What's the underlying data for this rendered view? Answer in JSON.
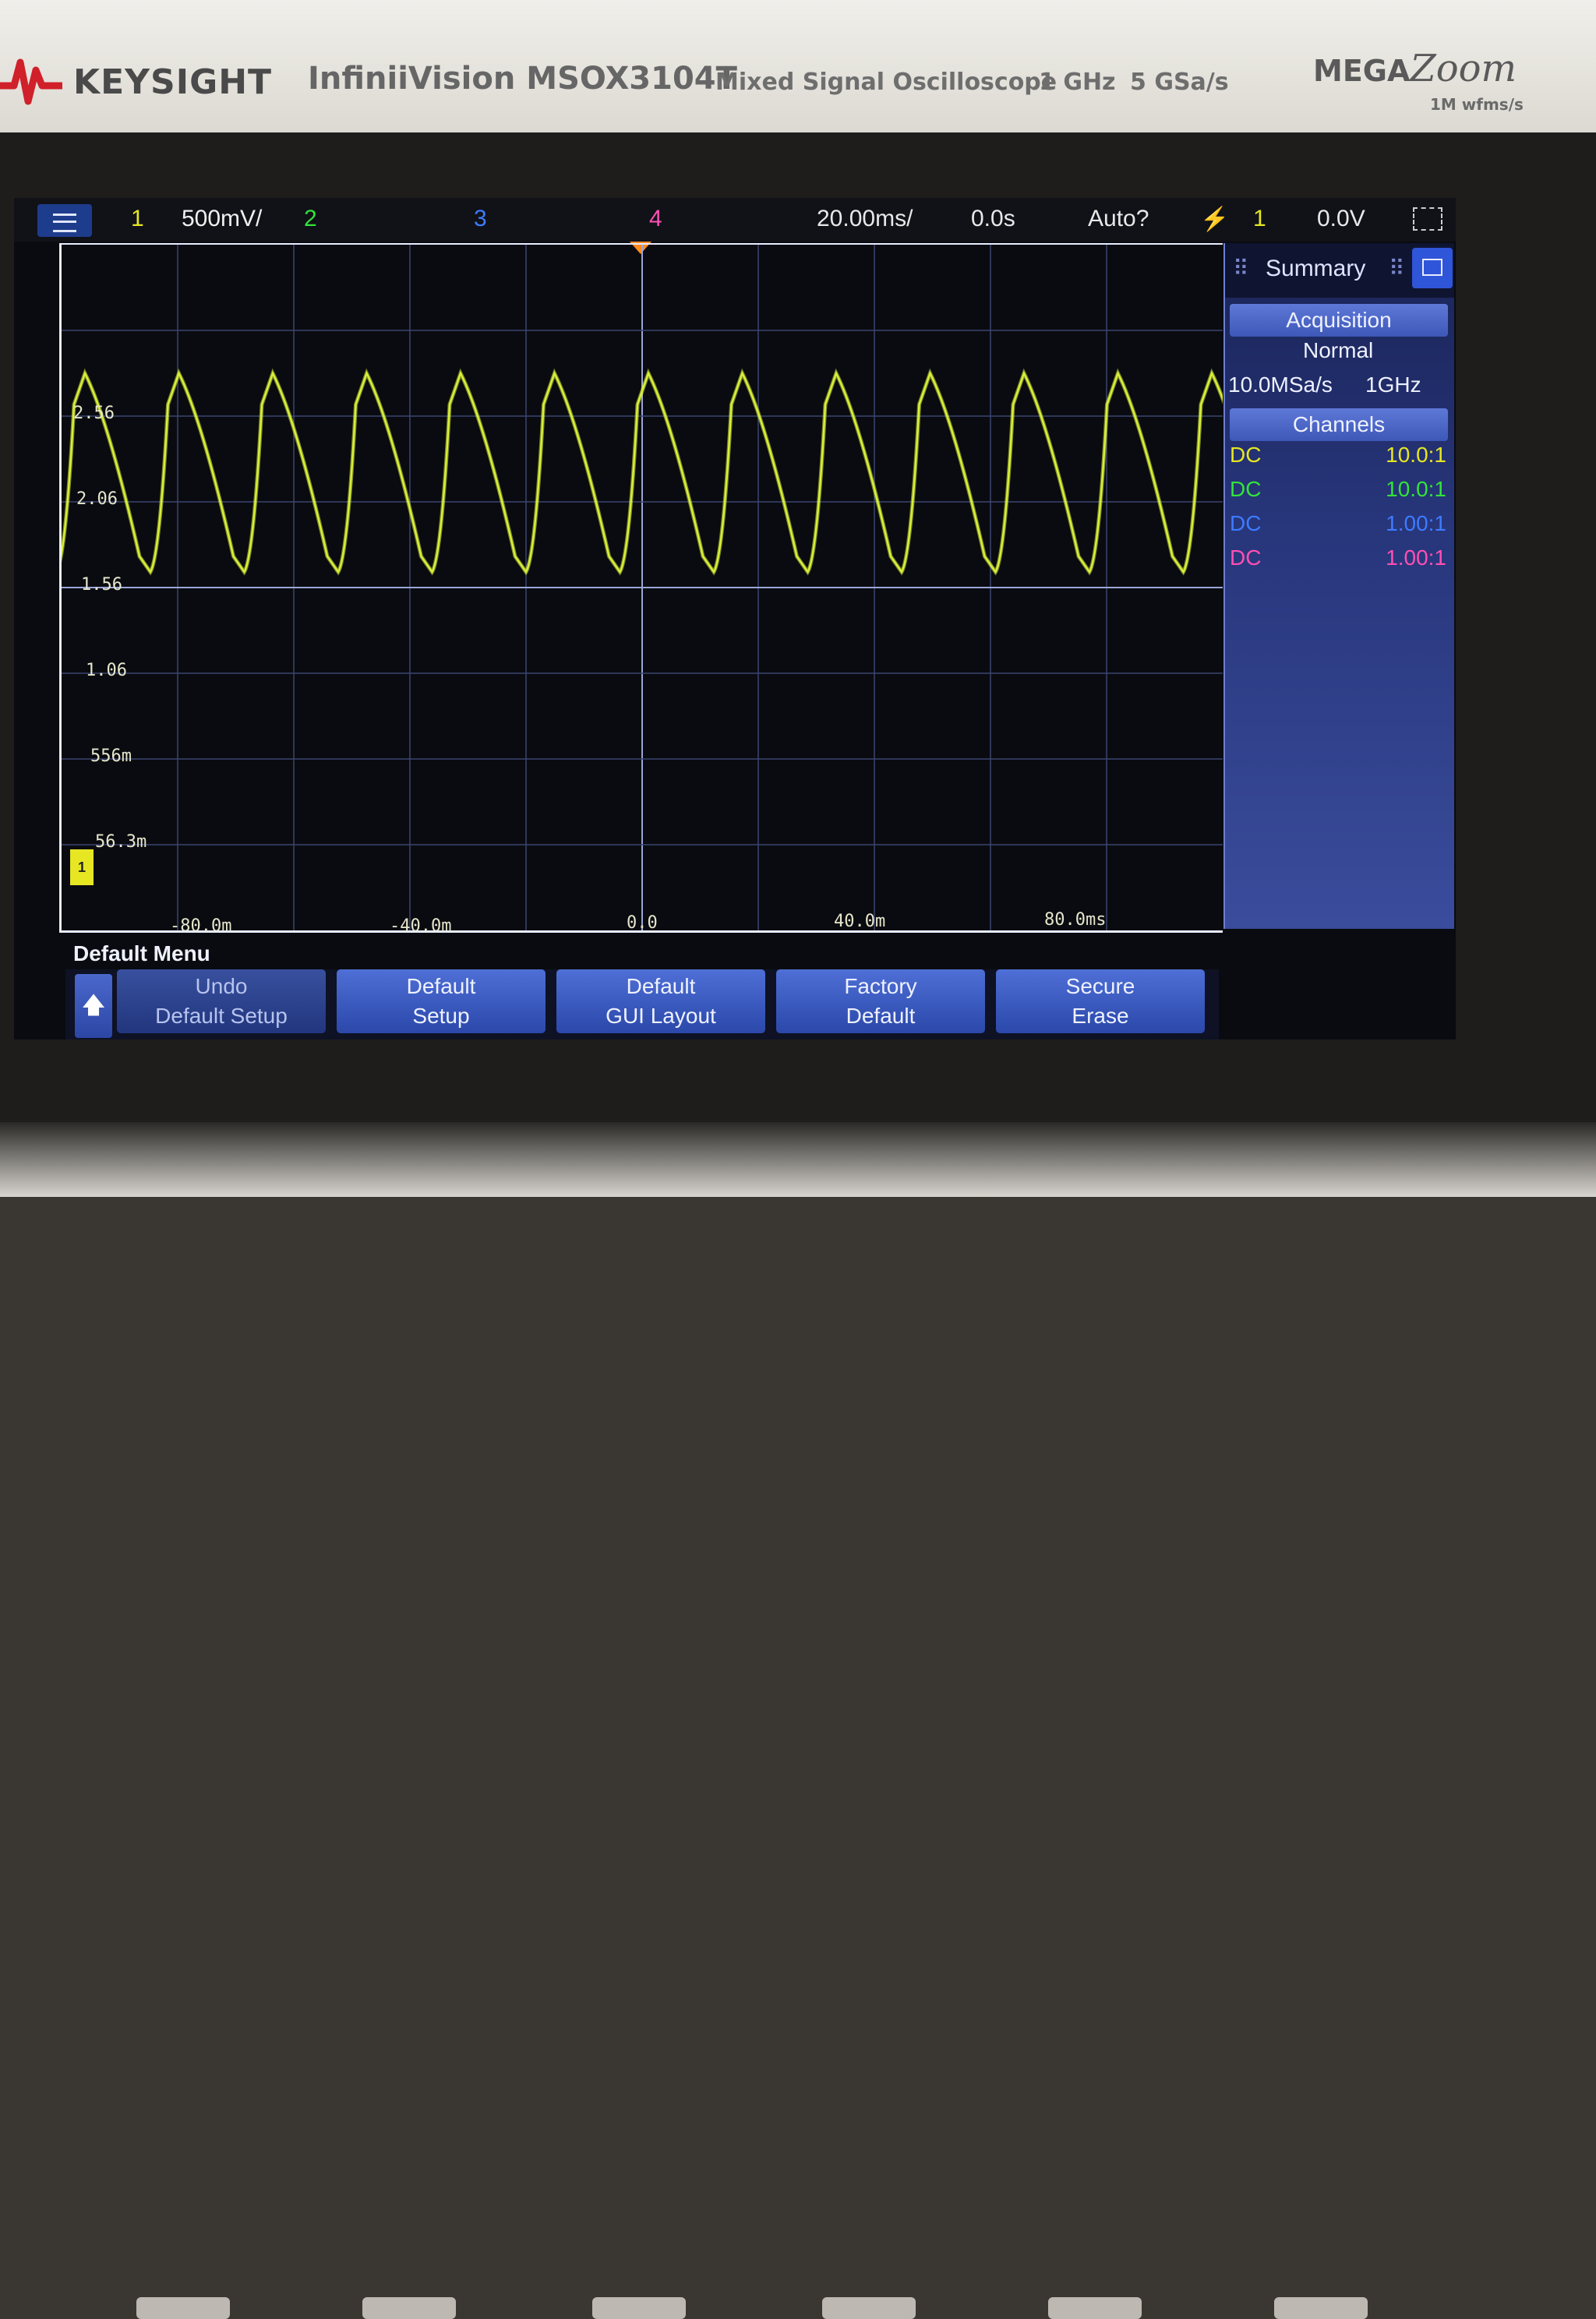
{
  "instrument": {
    "brand": "KEYSIGHT",
    "model": "InfiniiVision MSOX3104T",
    "description": "Mixed Signal Oscilloscope",
    "bandwidth": "1 GHz",
    "sample_rate": "5 GSa/s",
    "badge_word1": "MEGA",
    "badge_word2": "Zoom",
    "badge_sub": "1M wfms/s"
  },
  "status_bar": {
    "ch1_num": "1",
    "ch1_scale": "500mV/",
    "ch2_num": "2",
    "ch3_num": "3",
    "ch4_num": "4",
    "time_scale": "20.00ms/",
    "time_delay": "0.0s",
    "trigger_mode": "Auto?",
    "trigger_edge_icon": "rising-edge-icon",
    "trigger_source": "1",
    "trigger_level": "0.0V"
  },
  "waveform": {
    "y_labels": [
      "2.56",
      "2.06",
      "1.56",
      "1.06",
      "556m",
      "56.3m"
    ],
    "x_labels": [
      "-80.0m",
      "-40.0m",
      "0.0",
      "40.0m",
      "80.0ms"
    ],
    "ch1_marker": "1",
    "ch1_color": "#d8ef3a"
  },
  "sidebar": {
    "title": "Summary",
    "acquisition_label": "Acquisition",
    "acq_mode": "Normal",
    "acq_rate": "10.0MSa/s",
    "acq_bw": "1GHz",
    "channels_label": "Channels",
    "channels": [
      {
        "coupling": "DC",
        "ratio": "10.0:1",
        "color": "#e6e622"
      },
      {
        "coupling": "DC",
        "ratio": "10.0:1",
        "color": "#33e33a"
      },
      {
        "coupling": "DC",
        "ratio": "1.00:1",
        "color": "#3d7bff"
      },
      {
        "coupling": "DC",
        "ratio": "1.00:1",
        "color": "#ff4fb3"
      }
    ]
  },
  "softkeys": {
    "menu_title": "Default Menu",
    "keys": [
      {
        "line1": "Undo",
        "line2": "Default Setup"
      },
      {
        "line1": "Default",
        "line2": "Setup"
      },
      {
        "line1": "Default",
        "line2": "GUI Layout"
      },
      {
        "line1": "Factory",
        "line2": "Default"
      },
      {
        "line1": "Secure",
        "line2": "Erase"
      }
    ]
  }
}
